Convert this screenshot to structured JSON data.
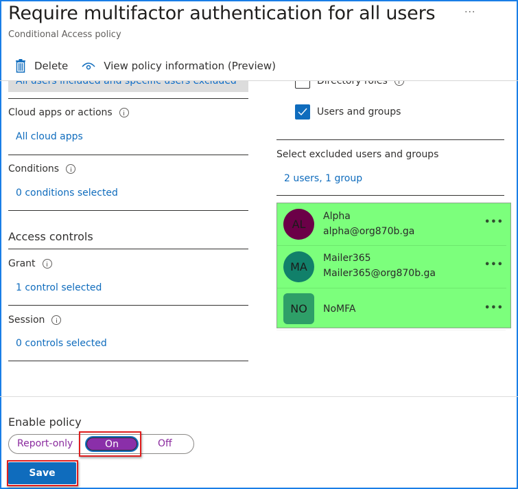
{
  "header": {
    "title": "Require multifactor authentication for all users",
    "subtitle": "Conditional Access policy",
    "more_icon": "ellipsis-icon"
  },
  "toolbar": {
    "delete_label": "Delete",
    "delete_icon": "trash-icon",
    "view_info_label": "View policy information (Preview)",
    "view_info_icon": "eye-icon"
  },
  "left": {
    "users_summary": "All users included and specific users excluded",
    "cloud_apps": {
      "label": "Cloud apps or actions",
      "value": "All cloud apps"
    },
    "conditions": {
      "label": "Conditions",
      "value": "0 conditions selected"
    },
    "access_controls_heading": "Access controls",
    "grant": {
      "label": "Grant",
      "value": "1 control selected"
    },
    "session": {
      "label": "Session",
      "value": "0 controls selected"
    }
  },
  "right": {
    "options": [
      {
        "label": "Directory roles",
        "checked": false
      },
      {
        "label": "Users and groups",
        "checked": true
      }
    ],
    "excluded_label": "Select excluded users and groups",
    "excluded_summary": "2 users, 1 group",
    "excluded": [
      {
        "initials": "AL",
        "name": "Alpha",
        "email": "alpha@org870b.ga",
        "color": "#6b0047",
        "shape": "round"
      },
      {
        "initials": "MA",
        "name": "Mailer365",
        "email": "Mailer365@org870b.ga",
        "color": "#11806a",
        "shape": "round"
      },
      {
        "initials": "NO",
        "name": "NoMFA",
        "email": "",
        "color": "#2e9f68",
        "shape": "square"
      }
    ],
    "highlight_color": "#7cff7c"
  },
  "footer": {
    "enable_label": "Enable policy",
    "toggle_options": [
      "Report-only",
      "On",
      "Off"
    ],
    "selected": "On",
    "save_label": "Save"
  }
}
